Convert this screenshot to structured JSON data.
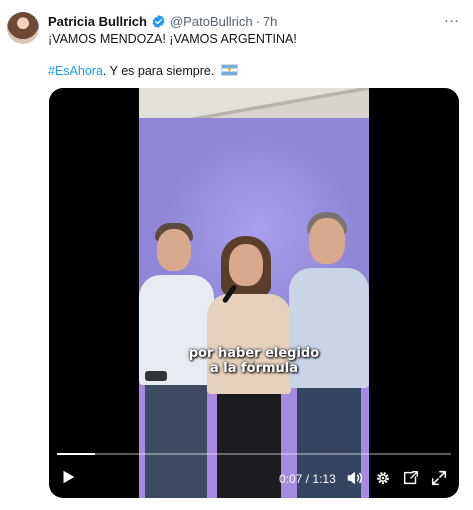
{
  "tweet": {
    "author_name": "Patricia Bullrich",
    "handle": "@PatoBullrich",
    "separator": "·",
    "time": "7h",
    "text_line1": "¡VAMOS MENDOZA! ¡VAMOS ARGENTINA!",
    "hashtag": "#EsAhora",
    "text_line2_rest": ". Y es para siempre.",
    "more_icon": "…"
  },
  "video": {
    "caption_line1": "por haber elegido",
    "caption_line2": "a la fórmula",
    "current_time": "0:07",
    "duration": "1:13",
    "time_separator": "/",
    "progress": 0.096
  },
  "colors": {
    "link": "#1d9bf0",
    "verified": "#1d9bf0",
    "secondary_text": "#536471",
    "stage_backdrop": "#8f86d8"
  },
  "icons": [
    "avatar",
    "verified-badge-icon",
    "more-icon",
    "argentina-flag-emoji",
    "play-icon",
    "volume-icon",
    "settings-gear-icon",
    "pip-icon",
    "fullscreen-icon"
  ]
}
